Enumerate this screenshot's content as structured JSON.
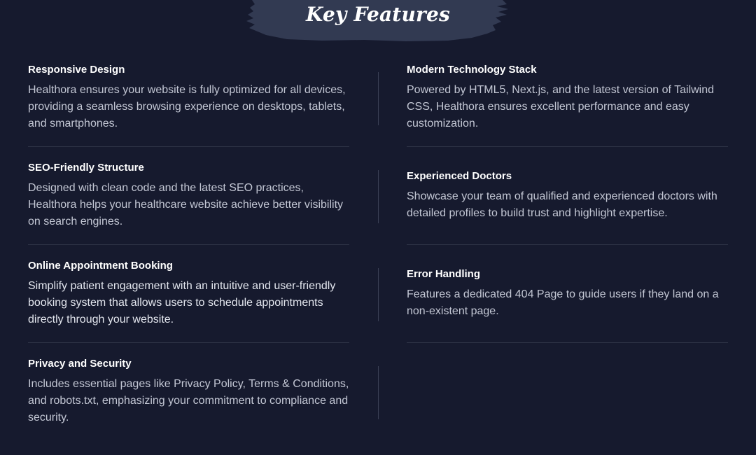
{
  "section": {
    "title": "Key Features"
  },
  "features_left": [
    {
      "title": "Responsive Design",
      "description": "Healthora ensures your website is fully optimized for all devices, providing a seamless browsing experience on desktops, tablets, and smartphones."
    },
    {
      "title": "SEO-Friendly Structure",
      "description": "Designed with clean code and the latest SEO practices, Healthora helps your healthcare website achieve better visibility on search engines."
    },
    {
      "title": "Online Appointment Booking",
      "description": "Simplify patient engagement with an intuitive and user-friendly booking system that allows users to schedule appointments directly through your website."
    },
    {
      "title": "Privacy and Security",
      "description": "Includes essential pages like Privacy Policy, Terms & Conditions, and robots.txt, emphasizing your commitment to compliance and security."
    }
  ],
  "features_right": [
    {
      "title": "Modern Technology Stack",
      "description": "Powered by HTML5, Next.js, and the latest version of Tailwind CSS, Healthora ensures excellent performance and easy customization."
    },
    {
      "title": "Experienced Doctors",
      "description": "Showcase your team of qualified and experienced doctors with detailed profiles to build trust and highlight expertise."
    },
    {
      "title": "Error Handling",
      "description": "Features a dedicated 404 Page to guide users if they land on a non-existent page."
    }
  ],
  "colors": {
    "background": "#161a2e",
    "brush": "#323a52",
    "title_text": "#ffffff",
    "body_text": "#c3c7d4",
    "divider": "#2e3346"
  }
}
